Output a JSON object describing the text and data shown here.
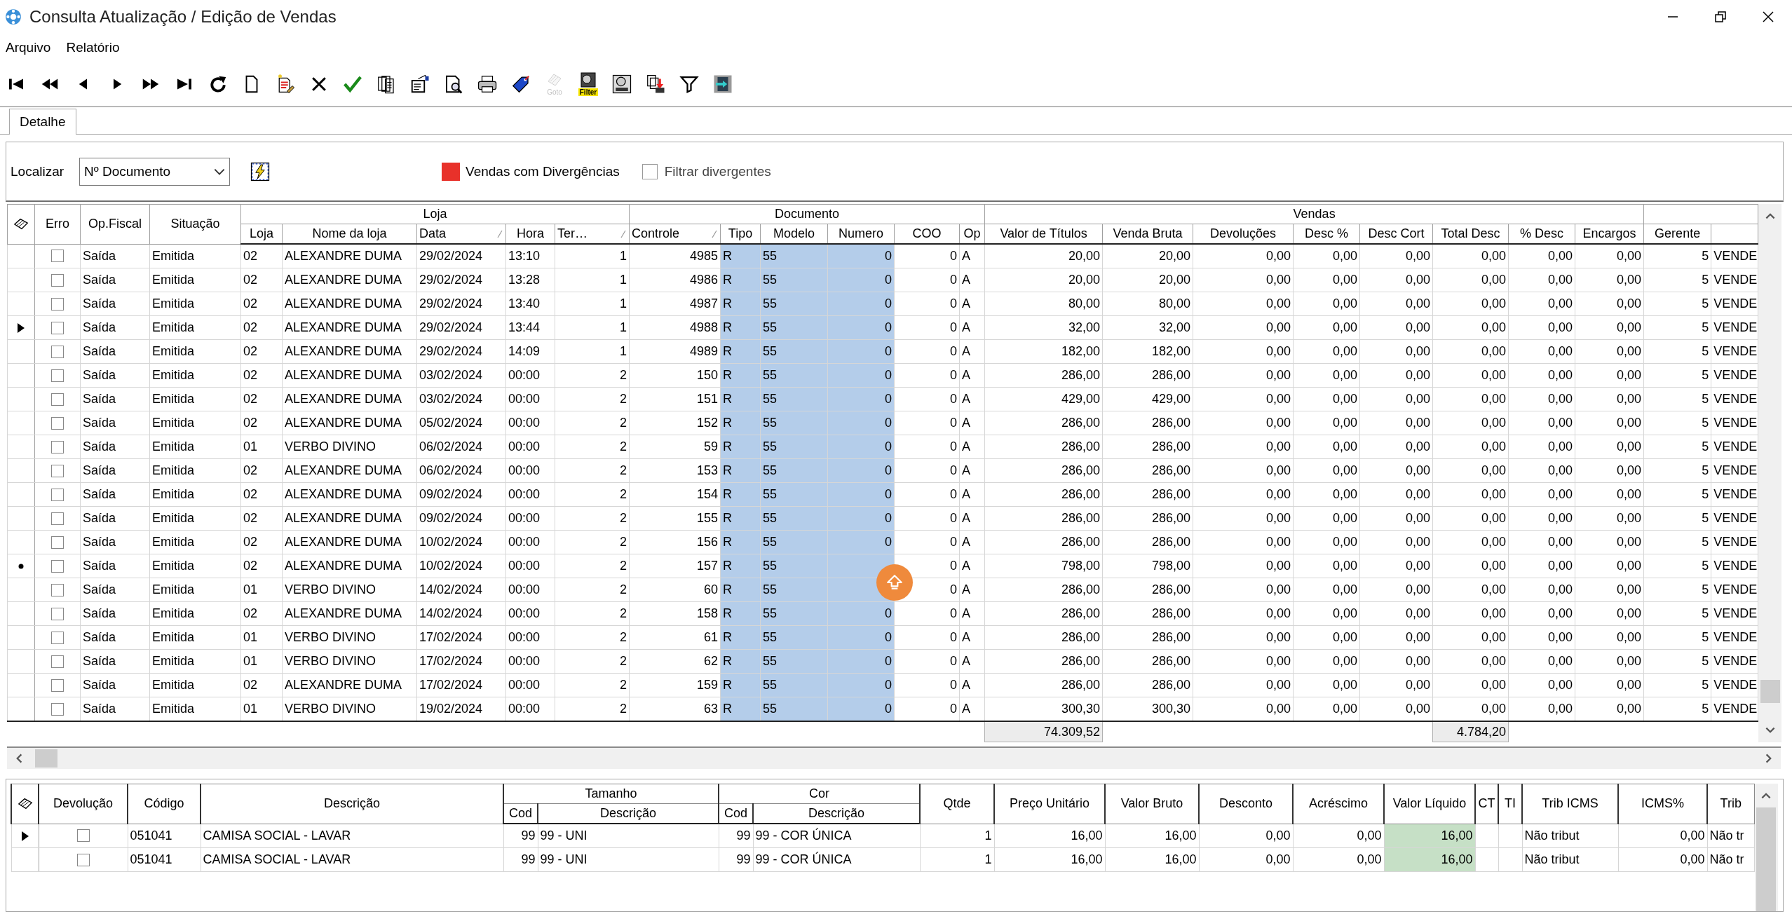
{
  "window": {
    "title": "Consulta Atualização / Edição de Vendas"
  },
  "menu": [
    {
      "label": "Arquivo"
    },
    {
      "label": "Relatório"
    }
  ],
  "toolbar": [
    {
      "kind": "first",
      "disabled": false
    },
    {
      "kind": "prev-page",
      "disabled": false
    },
    {
      "kind": "prev",
      "disabled": false
    },
    {
      "kind": "next",
      "disabled": false
    },
    {
      "kind": "next-page",
      "disabled": false
    },
    {
      "kind": "last",
      "disabled": false
    },
    {
      "kind": "refresh",
      "disabled": false
    },
    {
      "kind": "new",
      "disabled": false
    },
    {
      "kind": "edit",
      "disabled": false
    },
    {
      "kind": "delete",
      "disabled": false
    },
    {
      "kind": "confirm",
      "disabled": false
    },
    {
      "kind": "copy",
      "disabled": false
    },
    {
      "kind": "properties",
      "disabled": false
    },
    {
      "kind": "preview",
      "disabled": false
    },
    {
      "kind": "print",
      "disabled": false
    },
    {
      "kind": "tag",
      "disabled": false
    },
    {
      "kind": "goto",
      "disabled": true,
      "caption": "Goto"
    },
    {
      "kind": "filter-form",
      "disabled": false,
      "caption": "Filter"
    },
    {
      "kind": "form",
      "disabled": false
    },
    {
      "kind": "export",
      "disabled": false
    },
    {
      "kind": "funnel",
      "disabled": false
    },
    {
      "kind": "exit",
      "disabled": false
    }
  ],
  "tabs": [
    {
      "label": "Detalhe",
      "selected": true
    }
  ],
  "search": {
    "label": "Localizar",
    "field": {
      "value": "Nº Documento"
    }
  },
  "legend": {
    "label": "Vendas com Divergências",
    "color": "#e8312a"
  },
  "filter": {
    "label": "Filtrar divergentes",
    "checked": false
  },
  "sales_grid": {
    "groups": [
      {
        "kind": "single",
        "columns": [
          {
            "kind": "indicator",
            "sorted": false
          },
          {
            "kind": "check",
            "label": "Erro",
            "sorted": false
          },
          {
            "kind": "text",
            "label": "Op.Fiscal",
            "sorted": false
          },
          {
            "kind": "text",
            "label": "Situação",
            "sorted": false
          }
        ]
      },
      {
        "kind": "band",
        "label": "Loja",
        "columns": [
          {
            "kind": "text",
            "label": "Loja",
            "sorted": false
          },
          {
            "kind": "text",
            "label": "Nome da loja",
            "sorted": false
          },
          {
            "kind": "text",
            "label": "Data",
            "sorted": true
          },
          {
            "kind": "text",
            "label": "Hora",
            "sorted": false
          },
          {
            "kind": "number",
            "label": "Ter…",
            "sorted": true
          }
        ]
      },
      {
        "kind": "band",
        "label": "Documento",
        "columns": [
          {
            "kind": "number",
            "label": "Controle",
            "sorted": true
          },
          {
            "kind": "text",
            "label": "Tipo",
            "sorted": false,
            "highlighted": true
          },
          {
            "kind": "text",
            "label": "Modelo",
            "sorted": false,
            "highlighted": true
          },
          {
            "kind": "number",
            "label": "Numero",
            "sorted": false,
            "highlighted": true
          },
          {
            "kind": "number",
            "label": "COO",
            "sorted": false
          },
          {
            "kind": "text",
            "label": "Op",
            "sorted": false
          }
        ]
      },
      {
        "kind": "band",
        "label": "Vendas",
        "columns": [
          {
            "kind": "number",
            "label": "Valor de Títulos",
            "sorted": false,
            "total": "74.309,52"
          },
          {
            "kind": "number",
            "label": "Venda Bruta",
            "sorted": false
          },
          {
            "kind": "number",
            "label": "Devoluções",
            "sorted": false
          },
          {
            "kind": "number",
            "label": "Desc %",
            "sorted": false
          },
          {
            "kind": "number",
            "label": "Desc Cort",
            "sorted": false
          },
          {
            "kind": "number",
            "label": "Total Desc",
            "sorted": false,
            "total": "4.784,20"
          },
          {
            "kind": "number",
            "label": "% Desc",
            "sorted": false
          },
          {
            "kind": "number",
            "label": "Encargos",
            "sorted": false
          }
        ]
      },
      {
        "kind": "plain",
        "columns": [
          {
            "kind": "number",
            "label": "Gerente",
            "sorted": false
          },
          {
            "kind": "text"
          }
        ]
      }
    ],
    "rows": [
      {
        "current": false,
        "marked": false,
        "error": false,
        "cells": [
          "Saída",
          "Emitida",
          "02",
          "ALEXANDRE DUMA",
          "29/02/2024",
          "13:10",
          "1",
          "4985",
          "R",
          "55",
          "0",
          "0",
          "A",
          "20,00",
          "20,00",
          "0,00",
          "0,00",
          "0,00",
          "0,00",
          "0,00",
          "0,00",
          "5",
          "VENDE"
        ]
      },
      {
        "current": false,
        "marked": false,
        "error": false,
        "cells": [
          "Saída",
          "Emitida",
          "02",
          "ALEXANDRE DUMA",
          "29/02/2024",
          "13:28",
          "1",
          "4986",
          "R",
          "55",
          "0",
          "0",
          "A",
          "20,00",
          "20,00",
          "0,00",
          "0,00",
          "0,00",
          "0,00",
          "0,00",
          "0,00",
          "5",
          "VENDE"
        ]
      },
      {
        "current": false,
        "marked": false,
        "error": false,
        "cells": [
          "Saída",
          "Emitida",
          "02",
          "ALEXANDRE DUMA",
          "29/02/2024",
          "13:40",
          "1",
          "4987",
          "R",
          "55",
          "0",
          "0",
          "A",
          "80,00",
          "80,00",
          "0,00",
          "0,00",
          "0,00",
          "0,00",
          "0,00",
          "0,00",
          "5",
          "VENDE"
        ]
      },
      {
        "current": true,
        "marked": false,
        "error": false,
        "cells": [
          "Saída",
          "Emitida",
          "02",
          "ALEXANDRE DUMA",
          "29/02/2024",
          "13:44",
          "1",
          "4988",
          "R",
          "55",
          "0",
          "0",
          "A",
          "32,00",
          "32,00",
          "0,00",
          "0,00",
          "0,00",
          "0,00",
          "0,00",
          "0,00",
          "5",
          "VENDE"
        ]
      },
      {
        "current": false,
        "marked": false,
        "error": false,
        "cells": [
          "Saída",
          "Emitida",
          "02",
          "ALEXANDRE DUMA",
          "29/02/2024",
          "14:09",
          "1",
          "4989",
          "R",
          "55",
          "0",
          "0",
          "A",
          "182,00",
          "182,00",
          "0,00",
          "0,00",
          "0,00",
          "0,00",
          "0,00",
          "0,00",
          "5",
          "VENDE"
        ]
      },
      {
        "current": false,
        "marked": false,
        "error": false,
        "cells": [
          "Saída",
          "Emitida",
          "02",
          "ALEXANDRE DUMA",
          "03/02/2024",
          "00:00",
          "2",
          "150",
          "R",
          "55",
          "0",
          "0",
          "A",
          "286,00",
          "286,00",
          "0,00",
          "0,00",
          "0,00",
          "0,00",
          "0,00",
          "0,00",
          "5",
          "VENDE"
        ]
      },
      {
        "current": false,
        "marked": false,
        "error": false,
        "cells": [
          "Saída",
          "Emitida",
          "02",
          "ALEXANDRE DUMA",
          "03/02/2024",
          "00:00",
          "2",
          "151",
          "R",
          "55",
          "0",
          "0",
          "A",
          "429,00",
          "429,00",
          "0,00",
          "0,00",
          "0,00",
          "0,00",
          "0,00",
          "0,00",
          "5",
          "VENDE"
        ]
      },
      {
        "current": false,
        "marked": false,
        "error": false,
        "cells": [
          "Saída",
          "Emitida",
          "02",
          "ALEXANDRE DUMA",
          "05/02/2024",
          "00:00",
          "2",
          "152",
          "R",
          "55",
          "0",
          "0",
          "A",
          "286,00",
          "286,00",
          "0,00",
          "0,00",
          "0,00",
          "0,00",
          "0,00",
          "0,00",
          "5",
          "VENDE"
        ]
      },
      {
        "current": false,
        "marked": false,
        "error": false,
        "cells": [
          "Saída",
          "Emitida",
          "01",
          "VERBO DIVINO",
          "06/02/2024",
          "00:00",
          "2",
          "59",
          "R",
          "55",
          "0",
          "0",
          "A",
          "286,00",
          "286,00",
          "0,00",
          "0,00",
          "0,00",
          "0,00",
          "0,00",
          "0,00",
          "5",
          "VENDE"
        ]
      },
      {
        "current": false,
        "marked": false,
        "error": false,
        "cells": [
          "Saída",
          "Emitida",
          "02",
          "ALEXANDRE DUMA",
          "06/02/2024",
          "00:00",
          "2",
          "153",
          "R",
          "55",
          "0",
          "0",
          "A",
          "286,00",
          "286,00",
          "0,00",
          "0,00",
          "0,00",
          "0,00",
          "0,00",
          "0,00",
          "5",
          "VENDE"
        ]
      },
      {
        "current": false,
        "marked": false,
        "error": false,
        "cells": [
          "Saída",
          "Emitida",
          "02",
          "ALEXANDRE DUMA",
          "09/02/2024",
          "00:00",
          "2",
          "154",
          "R",
          "55",
          "0",
          "0",
          "A",
          "286,00",
          "286,00",
          "0,00",
          "0,00",
          "0,00",
          "0,00",
          "0,00",
          "0,00",
          "5",
          "VENDE"
        ]
      },
      {
        "current": false,
        "marked": false,
        "error": false,
        "cells": [
          "Saída",
          "Emitida",
          "02",
          "ALEXANDRE DUMA",
          "09/02/2024",
          "00:00",
          "2",
          "155",
          "R",
          "55",
          "0",
          "0",
          "A",
          "286,00",
          "286,00",
          "0,00",
          "0,00",
          "0,00",
          "0,00",
          "0,00",
          "0,00",
          "5",
          "VENDE"
        ]
      },
      {
        "current": false,
        "marked": false,
        "error": false,
        "cells": [
          "Saída",
          "Emitida",
          "02",
          "ALEXANDRE DUMA",
          "10/02/2024",
          "00:00",
          "2",
          "156",
          "R",
          "55",
          "0",
          "0",
          "A",
          "286,00",
          "286,00",
          "0,00",
          "0,00",
          "0,00",
          "0,00",
          "0,00",
          "0,00",
          "5",
          "VENDE"
        ]
      },
      {
        "current": false,
        "marked": true,
        "error": false,
        "cells": [
          "Saída",
          "Emitida",
          "02",
          "ALEXANDRE DUMA",
          "10/02/2024",
          "00:00",
          "2",
          "157",
          "R",
          "55",
          null,
          "0",
          "A",
          "798,00",
          "798,00",
          "0,00",
          "0,00",
          "0,00",
          "0,00",
          "0,00",
          "0,00",
          "5",
          "VENDE"
        ]
      },
      {
        "current": false,
        "marked": false,
        "error": false,
        "cells": [
          "Saída",
          "Emitida",
          "01",
          "VERBO DIVINO",
          "14/02/2024",
          "00:00",
          "2",
          "60",
          "R",
          "55",
          null,
          "0",
          "A",
          "286,00",
          "286,00",
          "0,00",
          "0,00",
          "0,00",
          "0,00",
          "0,00",
          "0,00",
          "5",
          "VENDE"
        ]
      },
      {
        "current": false,
        "marked": false,
        "error": false,
        "cells": [
          "Saída",
          "Emitida",
          "02",
          "ALEXANDRE DUMA",
          "14/02/2024",
          "00:00",
          "2",
          "158",
          "R",
          "55",
          "0",
          "0",
          "A",
          "286,00",
          "286,00",
          "0,00",
          "0,00",
          "0,00",
          "0,00",
          "0,00",
          "0,00",
          "5",
          "VENDE"
        ]
      },
      {
        "current": false,
        "marked": false,
        "error": false,
        "cells": [
          "Saída",
          "Emitida",
          "01",
          "VERBO DIVINO",
          "17/02/2024",
          "00:00",
          "2",
          "61",
          "R",
          "55",
          "0",
          "0",
          "A",
          "286,00",
          "286,00",
          "0,00",
          "0,00",
          "0,00",
          "0,00",
          "0,00",
          "0,00",
          "5",
          "VENDE"
        ]
      },
      {
        "current": false,
        "marked": false,
        "error": false,
        "cells": [
          "Saída",
          "Emitida",
          "01",
          "VERBO DIVINO",
          "17/02/2024",
          "00:00",
          "2",
          "62",
          "R",
          "55",
          "0",
          "0",
          "A",
          "286,00",
          "286,00",
          "0,00",
          "0,00",
          "0,00",
          "0,00",
          "0,00",
          "0,00",
          "5",
          "VENDE"
        ]
      },
      {
        "current": false,
        "marked": false,
        "error": false,
        "cells": [
          "Saída",
          "Emitida",
          "02",
          "ALEXANDRE DUMA",
          "17/02/2024",
          "00:00",
          "2",
          "159",
          "R",
          "55",
          "0",
          "0",
          "A",
          "286,00",
          "286,00",
          "0,00",
          "0,00",
          "0,00",
          "0,00",
          "0,00",
          "0,00",
          "5",
          "VENDE"
        ]
      },
      {
        "current": false,
        "marked": false,
        "error": false,
        "cells": [
          "Saída",
          "Emitida",
          "01",
          "VERBO DIVINO",
          "19/02/2024",
          "00:00",
          "2",
          "63",
          "R",
          "55",
          "0",
          "0",
          "A",
          "300,30",
          "300,30",
          "0,00",
          "0,00",
          "0,00",
          "0,00",
          "0,00",
          "0,00",
          "5",
          "VENDE"
        ]
      }
    ]
  },
  "items_grid": {
    "groups": [
      {
        "kind": "single",
        "columns": [
          {
            "kind": "indicator"
          },
          {
            "kind": "check",
            "label": "Devolução"
          },
          {
            "kind": "text",
            "label": "Código"
          },
          {
            "kind": "text",
            "label": "Descrição"
          }
        ]
      },
      {
        "kind": "band",
        "label": "Tamanho",
        "columns": [
          {
            "kind": "number",
            "label": "Cod"
          },
          {
            "kind": "text",
            "label": "Descrição"
          }
        ]
      },
      {
        "kind": "band",
        "label": "Cor",
        "columns": [
          {
            "kind": "number",
            "label": "Cod"
          },
          {
            "kind": "text",
            "label": "Descrição"
          }
        ]
      },
      {
        "kind": "single",
        "columns": [
          {
            "kind": "number",
            "label": "Qtde"
          },
          {
            "kind": "number",
            "label": "Preço Unitário"
          },
          {
            "kind": "number",
            "label": "Valor Bruto"
          },
          {
            "kind": "number",
            "label": "Desconto"
          },
          {
            "kind": "number",
            "label": "Acréscimo"
          },
          {
            "kind": "number",
            "label": "Valor Líquido",
            "highlighted": true
          },
          {
            "kind": "text",
            "label": "CT"
          },
          {
            "kind": "text",
            "label": "TI"
          },
          {
            "kind": "text",
            "label": "Trib ICMS"
          },
          {
            "kind": "number",
            "label": "ICMS%"
          },
          {
            "kind": "text",
            "label": "Trib"
          }
        ]
      }
    ],
    "rows": [
      {
        "current": true,
        "marked": false,
        "error": false,
        "cells": [
          "051041",
          "CAMISA SOCIAL - LAVAR",
          "99",
          "99 - UNI",
          "99",
          "99 - COR ÚNICA",
          "1",
          "16,00",
          "16,00",
          "0,00",
          "0,00",
          "16,00",
          null,
          null,
          "Não tribut",
          "0,00",
          "Não tr"
        ]
      },
      {
        "current": false,
        "marked": false,
        "error": false,
        "cells": [
          "051041",
          "CAMISA SOCIAL - LAVAR",
          "99",
          "99 - UNI",
          "99",
          "99 - COR ÚNICA",
          "1",
          "16,00",
          "16,00",
          "0,00",
          "0,00",
          "16,00",
          null,
          null,
          "Não tribut",
          "0,00",
          "Não tr"
        ]
      }
    ]
  }
}
